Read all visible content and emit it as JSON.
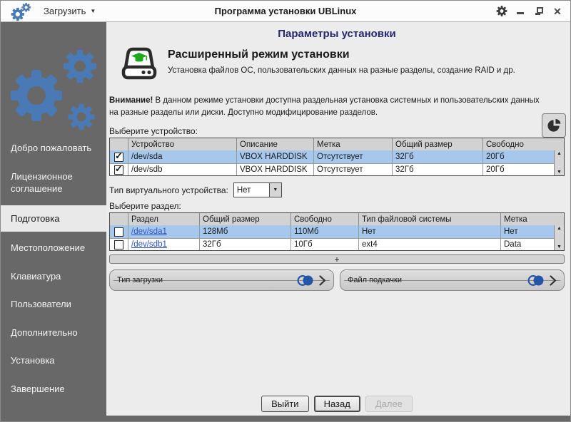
{
  "icons": {
    "check": "✓",
    "dropdown_arrow": "▼",
    "menu_arrow": "▼",
    "scroll_up": "▲",
    "scroll_down": "▼",
    "plus": "+"
  },
  "colors": {
    "accent_blue": "#4a7ab5",
    "selection_blue": "#a6c8ec",
    "link_blue": "#2a52c8",
    "title_navy": "#26266e",
    "sidebar_gray": "#686868",
    "cap_green": "#1da81d"
  },
  "window": {
    "title": "Программа установки UBLinux",
    "load_menu": "Загрузить"
  },
  "sidebar": {
    "active_item": "Подготовка",
    "items": [
      {
        "label": "Добро пожаловать"
      },
      {
        "label": "Лицензионное соглашение"
      },
      {
        "label": "Подготовка"
      },
      {
        "label": "Местоположение"
      },
      {
        "label": "Клавиатура"
      },
      {
        "label": "Пользователи"
      },
      {
        "label": "Дополнительно"
      },
      {
        "label": "Установка"
      },
      {
        "label": "Завершение"
      }
    ]
  },
  "main": {
    "page_title": "Параметры установки",
    "mode": {
      "title": "Расширенный режим установки",
      "description": "Установка файлов ОС, пользовательских данных на разные разделы, создание RAID и др."
    },
    "warning_bold": "Внимание!",
    "warning_text": " В данном режиме установки доступна раздельная установка системных и пользовательских данных на разные разделы или диски. Доступно модифицирование разделов.",
    "device_section": {
      "label": "Выберите устройство:",
      "headers": [
        "Устройство",
        "Описание",
        "Метка",
        "Общий размер",
        "Свободно"
      ],
      "rows": [
        {
          "checked": true,
          "selected": true,
          "cells": [
            "/dev/sda",
            "VBOX HARDDISK",
            "Отсутствует",
            "32Гб",
            "20Гб"
          ]
        },
        {
          "checked": true,
          "selected": false,
          "cells": [
            "/dev/sdb",
            "VBOX HARDDISK",
            "Отсутствует",
            "32Гб",
            "20Гб"
          ]
        }
      ]
    },
    "virtual_device": {
      "label": "Тип виртуального устройства:",
      "value": "Нет"
    },
    "partition_section": {
      "label": "Выберите раздел:",
      "headers": [
        "Раздел",
        "Общий размер",
        "Свободно",
        "Тип файловой системы",
        "Метка"
      ],
      "rows": [
        {
          "checked": false,
          "selected": true,
          "partition": "/dev/sda1",
          "cells": [
            "128Мб",
            "110Мб",
            "Нет",
            "Нет"
          ]
        },
        {
          "checked": false,
          "selected": false,
          "partition": "/dev/sdb1",
          "cells": [
            "32Гб",
            "10Гб",
            "ext4",
            "Data"
          ]
        }
      ]
    },
    "expanders": [
      {
        "label": "Тип загрузки"
      },
      {
        "label": "Файл подкачки"
      }
    ],
    "buttons": {
      "exit": "Выйти",
      "back": "Назад",
      "next": "Далее"
    }
  }
}
